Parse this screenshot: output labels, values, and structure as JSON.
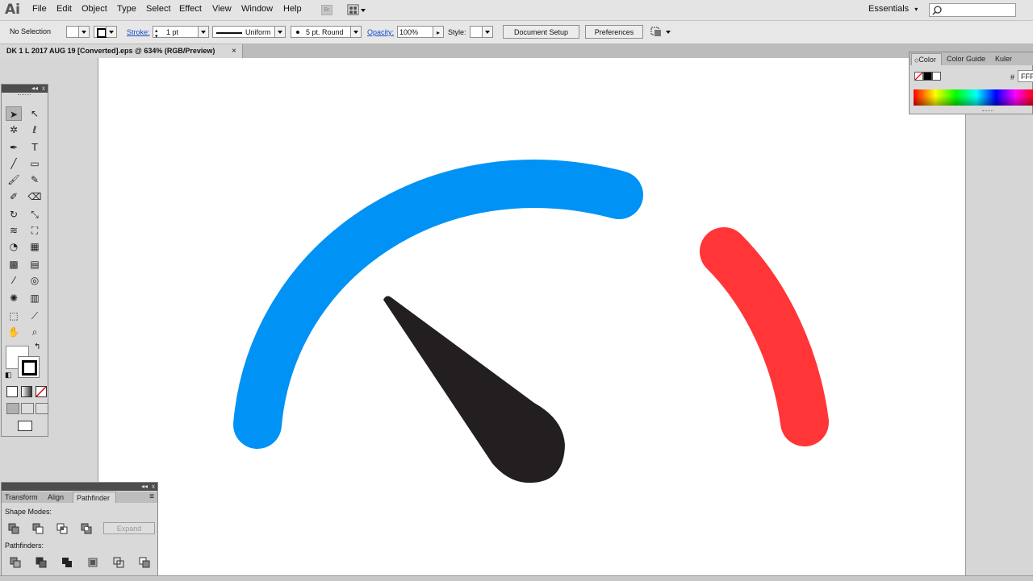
{
  "app": {
    "logo": "Ai"
  },
  "menubar": {
    "items": [
      "File",
      "Edit",
      "Object",
      "Type",
      "Select",
      "Effect",
      "View",
      "Window",
      "Help"
    ],
    "bridge_label": "Br",
    "workspace": "Essentials",
    "workspace_arrow": "▾",
    "search_placeholder": ""
  },
  "controlbar": {
    "selection": "No Selection",
    "stroke_label": "Stroke:",
    "stroke_weight": "1 pt",
    "profile": "Uniform",
    "brush": "5 pt. Round",
    "opacity_label": "Opacity:",
    "opacity_value": "100%",
    "style_label": "Style:",
    "document_setup": "Document Setup",
    "preferences": "Preferences"
  },
  "document_tab": {
    "title": "DK 1 L 2017 AUG 19 [Converted].eps @ 634% (RGB/Preview)",
    "close": "×"
  },
  "tools_panel": {
    "collapse": "◂◂",
    "close": "x",
    "tools": [
      {
        "name": "selection-tool",
        "glyph": "➤"
      },
      {
        "name": "direct-selection-tool",
        "glyph": "↖"
      },
      {
        "name": "magic-wand-tool",
        "glyph": "✲"
      },
      {
        "name": "lasso-tool",
        "glyph": "ℓ"
      },
      {
        "name": "pen-tool",
        "glyph": "✒"
      },
      {
        "name": "type-tool",
        "glyph": "T"
      },
      {
        "name": "line-tool",
        "glyph": "╱"
      },
      {
        "name": "rectangle-tool",
        "glyph": "▭"
      },
      {
        "name": "paintbrush-tool",
        "glyph": "🖌"
      },
      {
        "name": "pencil-tool",
        "glyph": "✎"
      },
      {
        "name": "blob-brush-tool",
        "glyph": "✐"
      },
      {
        "name": "eraser-tool",
        "glyph": "⌫"
      },
      {
        "name": "rotate-tool",
        "glyph": "↻"
      },
      {
        "name": "scale-tool",
        "glyph": "⤡"
      },
      {
        "name": "warp-tool",
        "glyph": "≋"
      },
      {
        "name": "free-transform-tool",
        "glyph": "⛶"
      },
      {
        "name": "shape-builder-tool",
        "glyph": "◔"
      },
      {
        "name": "perspective-grid-tool",
        "glyph": "▦"
      },
      {
        "name": "mesh-tool",
        "glyph": "▩"
      },
      {
        "name": "gradient-tool",
        "glyph": "▤"
      },
      {
        "name": "eyedropper-tool",
        "glyph": "⁄"
      },
      {
        "name": "blend-tool",
        "glyph": "◎"
      },
      {
        "name": "symbol-sprayer-tool",
        "glyph": "✺"
      },
      {
        "name": "column-graph-tool",
        "glyph": "▥"
      },
      {
        "name": "artboard-tool",
        "glyph": "⬚"
      },
      {
        "name": "slice-tool",
        "glyph": "⟋"
      },
      {
        "name": "hand-tool",
        "glyph": "✋"
      },
      {
        "name": "zoom-tool",
        "glyph": "⌕"
      }
    ],
    "swap_glyph": "↰",
    "default_glyph": "◧"
  },
  "pathfinder_panel": {
    "collapse": "◂◂",
    "close": "x",
    "tabs": [
      "Transform",
      "Align",
      "Pathfinder"
    ],
    "active_tab": "Pathfinder",
    "menu": "≡",
    "shape_modes_label": "Shape Modes:",
    "expand": "Expand",
    "pathfinders_label": "Pathfinders:"
  },
  "color_panel": {
    "tabs": [
      "Color",
      "Color Guide",
      "Kuler"
    ],
    "active_tab": "Color",
    "active_marker": "◇",
    "hex_label": "#",
    "hex_value": "FFFFFF"
  },
  "artwork": {
    "blue": "#0092f5",
    "red": "#ff3537",
    "needle": "#231f20",
    "arc_percent_blue": 0.62,
    "arc_percent_red": 0.22
  }
}
